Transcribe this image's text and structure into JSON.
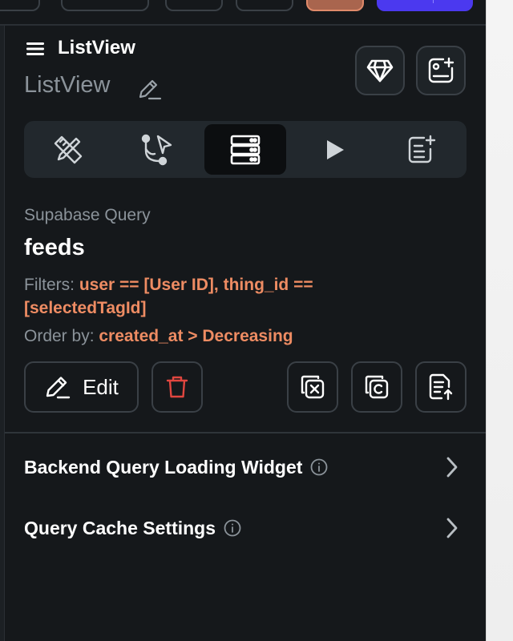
{
  "header": {
    "menu_icon": "hamburger-icon",
    "title": "ListView",
    "widget_name": "ListView",
    "edit_icon": "pencil-icon",
    "actions": [
      {
        "icon": "gem-icon"
      },
      {
        "icon": "add-widget-icon"
      }
    ]
  },
  "tabs": [
    {
      "icon": "ruler-pencil-icon",
      "selected": false
    },
    {
      "icon": "action-flow-icon",
      "selected": false
    },
    {
      "icon": "database-icon",
      "selected": true
    },
    {
      "icon": "play-icon",
      "selected": false
    },
    {
      "icon": "notes-add-icon",
      "selected": false
    }
  ],
  "query": {
    "type_label": "Supabase Query",
    "table": "feeds",
    "filters_label": "Filters:",
    "filters_value": "user == [User ID], thing_id == [selectedTagId]",
    "order_label": "Order by:",
    "order_value": "created_at > Decreasing"
  },
  "actions": {
    "edit_label": "Edit",
    "delete_icon": "trash-icon",
    "clear_icon": "clear-x-icon",
    "copy_icon": "copy-icon",
    "export_icon": "export-icon"
  },
  "sections": [
    {
      "label": "Backend Query Loading Widget"
    },
    {
      "label": "Query Cache Settings"
    }
  ],
  "colors": {
    "panel_bg": "#15181b",
    "accent_orange": "#ee8c63",
    "primary_purple": "#4b39ef",
    "delete_red": "#e0463f"
  }
}
